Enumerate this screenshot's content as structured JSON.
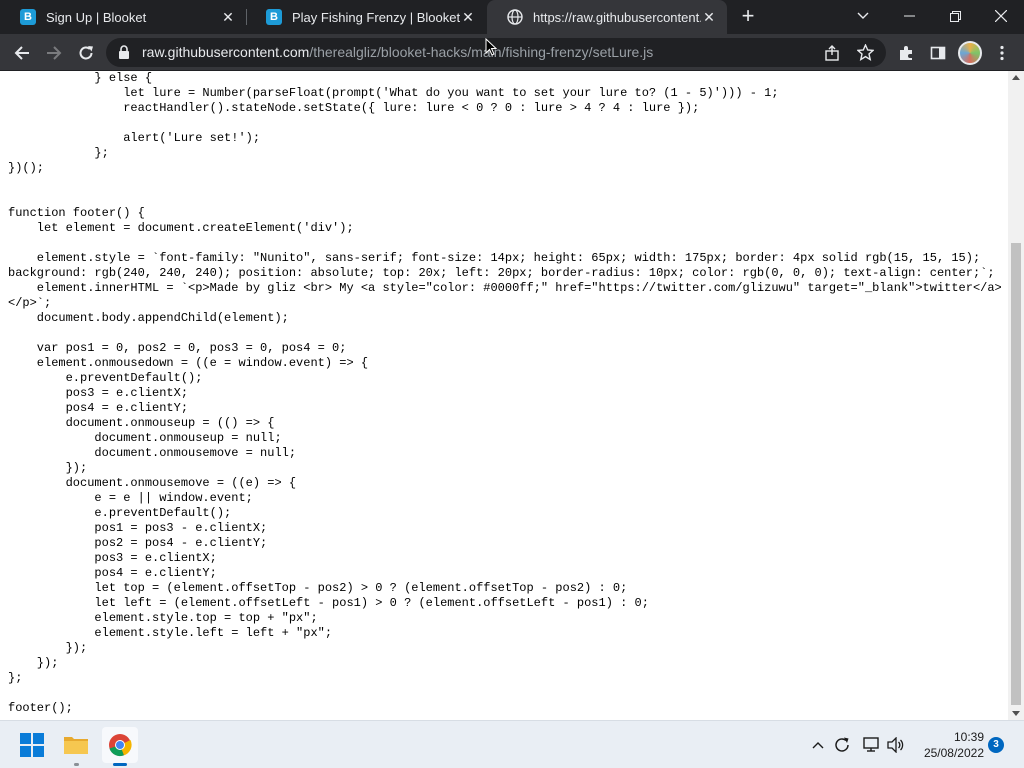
{
  "tabs": [
    {
      "title": "Sign Up | Blooket",
      "favicon": "blooket-icon",
      "active": false
    },
    {
      "title": "Play Fishing Frenzy | Blooket",
      "favicon": "blooket-icon",
      "active": false
    },
    {
      "title": "https://raw.githubusercontent.co",
      "favicon": "globe-icon",
      "active": true
    }
  ],
  "toolbar": {
    "url_host": "raw.githubusercontent.com",
    "url_path": "/therealgliz/blooket-hacks/main/fishing-frenzy/setLure.js"
  },
  "code": {
    "lines": [
      "            } else {",
      "                let lure = Number(parseFloat(prompt('What do you want to set your lure to? (1 - 5)'))) - 1;",
      "                reactHandler().stateNode.setState({ lure: lure < 0 ? 0 : lure > 4 ? 4 : lure });",
      "",
      "                alert('Lure set!');",
      "            };",
      "})();",
      "",
      "",
      "function footer() {",
      "    let element = document.createElement('div');",
      "",
      "    element.style = `font-family: \"Nunito\", sans-serif; font-size: 14px; height: 65px; width: 175px; border: 4px solid rgb(15, 15, 15);",
      "background: rgb(240, 240, 240); position: absolute; top: 20x; left: 20px; border-radius: 10px; color: rgb(0, 0, 0); text-align: center;`;",
      "    element.innerHTML = `<p>Made by gliz <br> My <a style=\"color: #0000ff;\" href=\"https://twitter.com/glizuwu\" target=\"_blank\">twitter</a>",
      "</p>`;",
      "    document.body.appendChild(element);",
      "",
      "    var pos1 = 0, pos2 = 0, pos3 = 0, pos4 = 0;",
      "    element.onmousedown = ((e = window.event) => {",
      "        e.preventDefault();",
      "        pos3 = e.clientX;",
      "        pos4 = e.clientY;",
      "        document.onmouseup = (() => {",
      "            document.onmouseup = null;",
      "            document.onmousemove = null;",
      "        });",
      "        document.onmousemove = ((e) => {",
      "            e = e || window.event;",
      "            e.preventDefault();",
      "            pos1 = pos3 - e.clientX;",
      "            pos2 = pos4 - e.clientY;",
      "            pos3 = e.clientX;",
      "            pos4 = e.clientY;",
      "            let top = (element.offsetTop - pos2) > 0 ? (element.offsetTop - pos2) : 0;",
      "            let left = (element.offsetLeft - pos1) > 0 ? (element.offsetLeft - pos1) : 0;",
      "            element.style.top = top + \"px\";",
      "            element.style.left = left + \"px\";",
      "        });",
      "    });",
      "};",
      "",
      "footer();"
    ]
  },
  "taskbar": {
    "time": "10:39",
    "date": "25/08/2022",
    "notification_count": "3"
  },
  "colors": {
    "tabstrip_bg": "#202124",
    "toolbar_bg": "#35363a",
    "accent": "#0067c0"
  }
}
